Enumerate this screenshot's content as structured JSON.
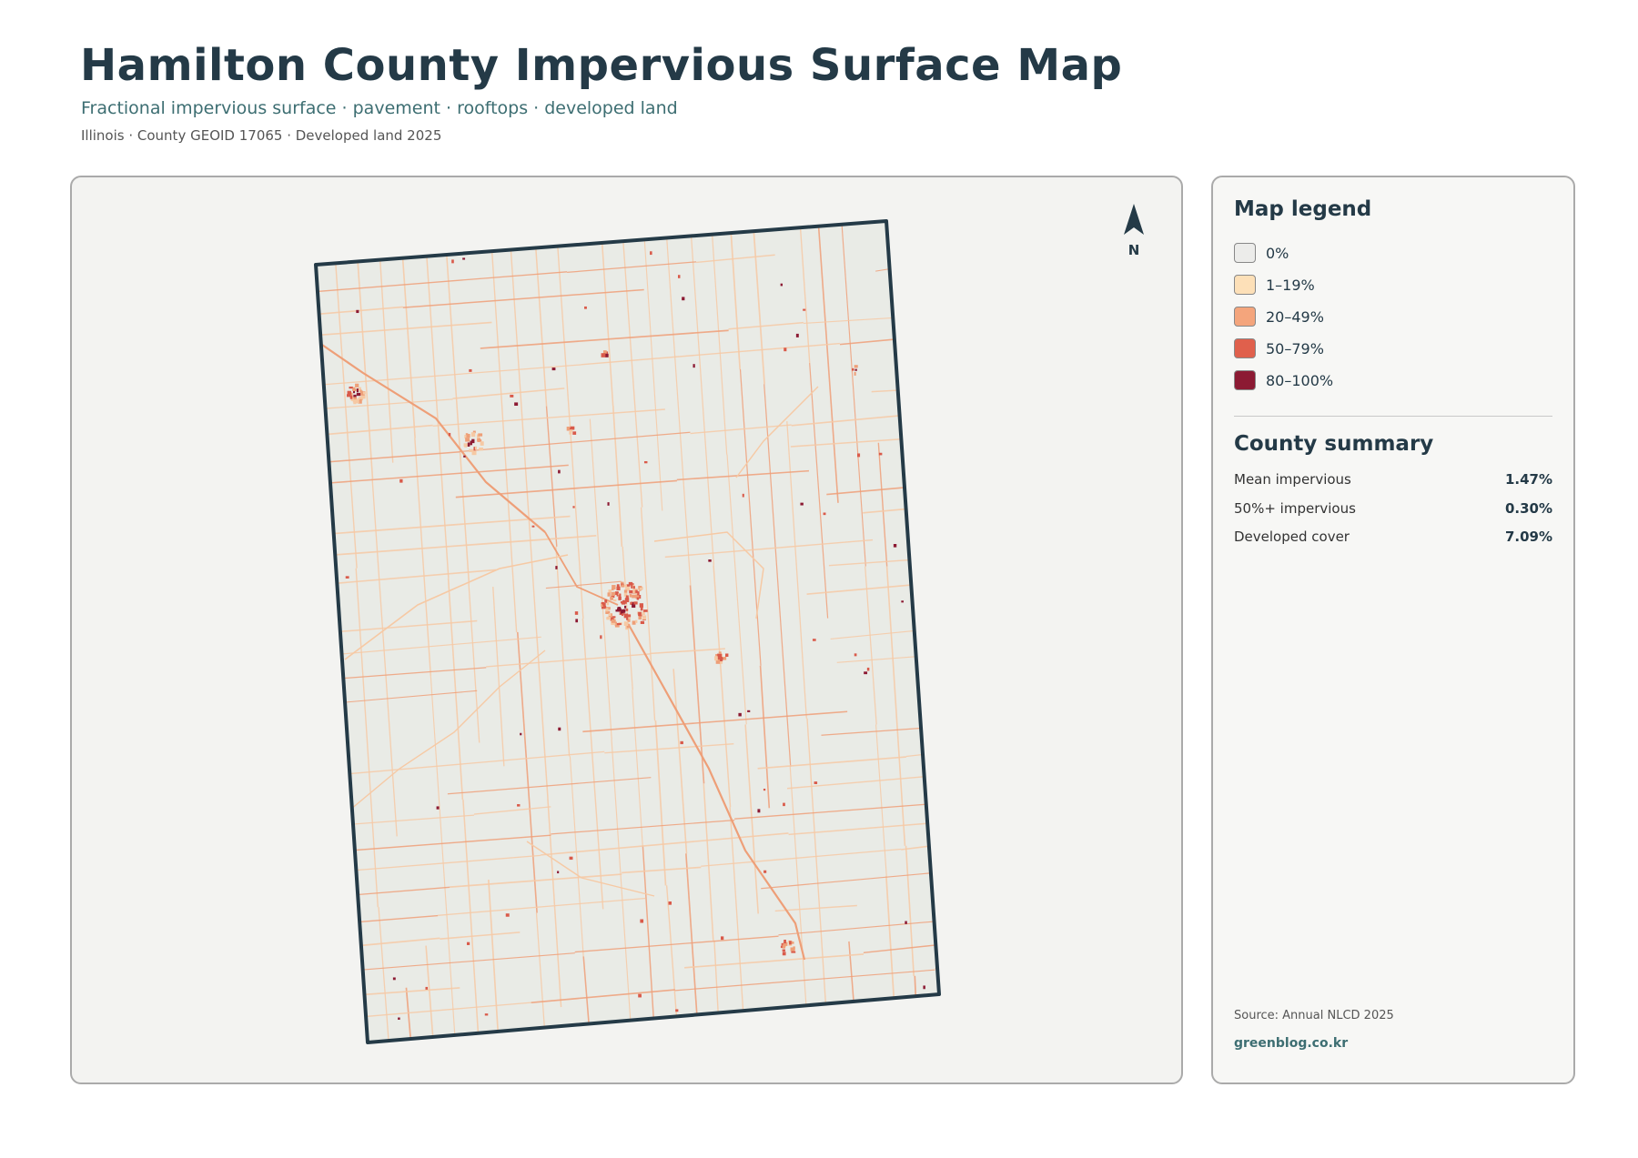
{
  "header": {
    "title": "Hamilton County Impervious Surface Map",
    "subtitle": "Fractional impervious surface · pavement · rooftops · developed land",
    "meta": "Illinois · County GEOID 17065 · Developed land 2025"
  },
  "map": {
    "north_label": "N",
    "colors": {
      "background": "#e9ebe6",
      "outline": "#243a47",
      "road_light": "#f6c9a4",
      "road": "#ee9f78",
      "dense": "#d95a4a",
      "core": "#8c1a33"
    }
  },
  "legend": {
    "heading": "Map legend",
    "items": [
      {
        "label": "0%",
        "color": "#ececea"
      },
      {
        "label": "1–19%",
        "color": "#fde0b8"
      },
      {
        "label": "20–49%",
        "color": "#f4a57c"
      },
      {
        "label": "50–79%",
        "color": "#e0604c"
      },
      {
        "label": "80–100%",
        "color": "#8c1a33"
      }
    ]
  },
  "summary": {
    "heading": "County summary",
    "stats": [
      {
        "label": "Mean impervious",
        "value": "1.47%"
      },
      {
        "label": "50%+ impervious",
        "value": "0.30%"
      },
      {
        "label": "Developed cover",
        "value": "7.09%"
      }
    ]
  },
  "footer": {
    "source": "Source: Annual NLCD 2025",
    "site": "greenblog.co.kr"
  }
}
